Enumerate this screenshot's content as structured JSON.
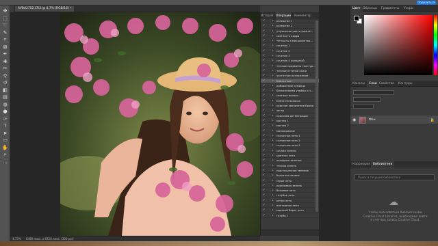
{
  "options_bar": {
    "share_label": "Поделиться"
  },
  "document": {
    "tab_title": "AVBA2752.CR3 @ 4,7% (RGB/16) *"
  },
  "tools": [
    "move-tool",
    "marquee-tool",
    "lasso-tool",
    "quick-select-tool",
    "crop-tool",
    "frame-tool",
    "eyedropper-tool",
    "healing-tool",
    "brush-tool",
    "stamp-tool",
    "history-brush-tool",
    "eraser-tool",
    "gradient-tool",
    "blur-tool",
    "dodge-tool",
    "pen-tool",
    "type-tool",
    "path-select-tool",
    "shape-tool",
    "hand-tool",
    "zoom-tool",
    "more-tools"
  ],
  "actions_panel": {
    "tabs": [
      "История",
      "Операции",
      "Комментар"
    ],
    "active_tab": "Операции",
    "items": [
      {
        "label": "размытие 1"
      },
      {
        "label": "размытие 2"
      },
      {
        "label": "улучшение цвета (цвета..."
      },
      {
        "label": "светлость кадра"
      },
      {
        "label": "Четкость в микроконтра..."
      },
      {
        "label": "сочетие 1"
      },
      {
        "label": "сочетие 2"
      },
      {
        "label": "сочетие 3"
      },
      {
        "label": "сочетие 4 холодный"
      },
      {
        "label": "теплые предметы текстур..."
      },
      {
        "label": "теплые оттенки кожи"
      },
      {
        "label": "частотное разложение"
      },
      {
        "label": "Блеск глаз",
        "selected": true
      },
      {
        "label": "добавление румянца"
      },
      {
        "label": "Белоснежная улыбка и з..."
      },
      {
        "label": "светлые волосы"
      },
      {
        "label": "Блеск на волосах"
      },
      {
        "label": "красное увеличение брови"
      },
      {
        "label": "загар"
      },
      {
        "label": "красивая дегенерация"
      },
      {
        "label": "мастер 1"
      },
      {
        "label": "мастер 2"
      },
      {
        "label": "монохромное"
      },
      {
        "label": "сказочное лето 1"
      },
      {
        "label": "сказочное лето 2"
      },
      {
        "label": "сказочное лето 3"
      },
      {
        "label": "сочная зелень"
      },
      {
        "label": "цветное лето"
      },
      {
        "label": "холодное зеленое"
      },
      {
        "label": "теплая зелень"
      },
      {
        "label": "приглушенное зеленое"
      },
      {
        "label": "болотная зелень"
      },
      {
        "label": "серое лето"
      },
      {
        "label": "оранжевая зелень"
      },
      {
        "label": "бежевое лето"
      },
      {
        "label": "голубое лето"
      },
      {
        "label": "ретро лето"
      },
      {
        "label": "винтажное лето"
      },
      {
        "label": "морской берег лето"
      },
      {
        "label": "голубь 1"
      }
    ]
  },
  "color_panel": {
    "tabs": [
      "Цвет",
      "Образцы",
      "Градиенты",
      "Узоры"
    ],
    "active_tab": "Цвет",
    "foreground": "#000000",
    "background": "#ffffff"
  },
  "layers_panel": {
    "tabs": [
      "Каналы",
      "Слои",
      "Свойства",
      "Контуры"
    ],
    "active_tab": "Слои",
    "layer_name": "Фон"
  },
  "library_panel": {
    "tabs": [
      "Коррекция",
      "Библиотеки"
    ],
    "active_tab": "Библиотеки",
    "search_placeholder": "Поиск в текущей библиотеке",
    "message": "Чтобы пользоваться библиотеками Creative Cloud Libraries, необходимо войти в учетную запись Creative Cloud."
  },
  "status": {
    "zoom": "4,73%",
    "doc_info": "6480 пикс. х 8720 пикс. (300 ppi)"
  }
}
